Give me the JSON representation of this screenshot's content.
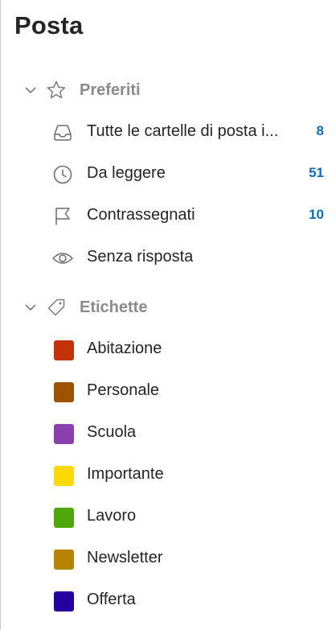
{
  "title": "Posta",
  "favorites": {
    "label": "Preferiti",
    "items": [
      {
        "label": "Tutte le cartelle di posta i...",
        "count": "8",
        "icon": "inbox-tray-icon"
      },
      {
        "label": "Da leggere",
        "count": "51",
        "icon": "clock-icon"
      },
      {
        "label": "Contrassegnati",
        "count": "10",
        "icon": "flag-icon"
      },
      {
        "label": "Senza risposta",
        "count": "",
        "icon": "eye-icon"
      }
    ]
  },
  "labels": {
    "label": "Etichette",
    "items": [
      {
        "label": "Abitazione",
        "color": "#c4320a"
      },
      {
        "label": "Personale",
        "color": "#9d5200"
      },
      {
        "label": "Scuola",
        "color": "#8a3fb0"
      },
      {
        "label": "Importante",
        "color": "#ffd800"
      },
      {
        "label": "Lavoro",
        "color": "#4ea80b"
      },
      {
        "label": "Newsletter",
        "color": "#b88400"
      },
      {
        "label": "Offerta",
        "color": "#2500a0"
      }
    ]
  },
  "colors": {
    "count": "#0f6cbd",
    "section_label": "#8a8a8a"
  }
}
